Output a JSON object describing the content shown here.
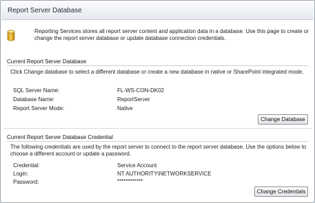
{
  "header": {
    "title": "Report Server Database"
  },
  "intro": {
    "icon": "database-icon",
    "text": "Reporting Services stores all report server content and application data in a database. Use this page to create or change the report server database or update database connection credentials."
  },
  "current_database": {
    "title": "Current Report Server Database",
    "description": "Click Change database to select a different database or create a new database in native or SharePoint integrated mode.",
    "fields": [
      {
        "label": "SQL Server Name:",
        "value": "FL-WS-CON-DK02"
      },
      {
        "label": "Database Name:",
        "value": "ReportServer"
      },
      {
        "label": "Report Server Mode:",
        "value": "Native"
      }
    ],
    "button_label": "Change Database"
  },
  "credential": {
    "title": "Current Report Server Database Credential",
    "description": "The following credentials are used by the report server to connect to the report server database.  Use the options below to choose a different account or update a password.",
    "fields": [
      {
        "label": "Credential:",
        "value": "Service Account"
      },
      {
        "label": "Login:",
        "value": "NT AUTHORITY\\NETWORKSERVICE"
      },
      {
        "label": "Password:",
        "value": "************"
      }
    ],
    "button_label": "Change Credentials"
  }
}
